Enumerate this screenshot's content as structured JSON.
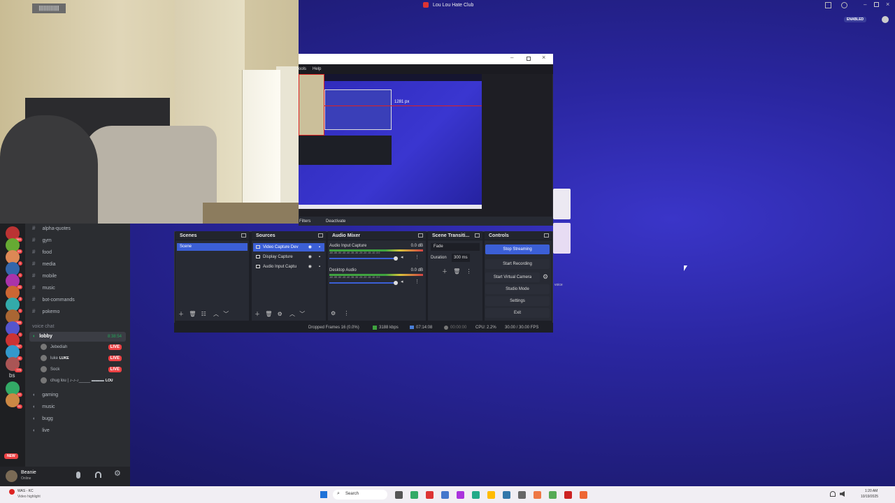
{
  "topbar": {
    "title": "Lou Lou Hate Club",
    "enabled_badge": "ENABLED"
  },
  "webcam": {
    "label": "||||||||||||||"
  },
  "discord": {
    "servers": [
      {
        "badge": "864"
      },
      {
        "badge": "63"
      },
      {
        "badge": "1"
      },
      {
        "badge": "1"
      },
      {
        "badge": "34"
      },
      {
        "badge": "3"
      },
      {
        "badge": "1"
      },
      {
        "badge": "366"
      },
      {
        "badge": "1"
      },
      {
        "badge": "267"
      },
      {
        "badge": "11"
      },
      {
        "badge": "779"
      },
      {
        "badge": "92"
      },
      {
        "badge": "61"
      }
    ],
    "server_initials": "bs",
    "new_badge": "NEW",
    "channels": [
      {
        "name": "alpha-quotes"
      },
      {
        "name": "gym"
      },
      {
        "name": "food"
      },
      {
        "name": "media"
      },
      {
        "name": "mobile"
      },
      {
        "name": "music"
      },
      {
        "name": "bot-commands"
      },
      {
        "name": "pokemo"
      }
    ],
    "voice_category": "voice chat",
    "lobby": {
      "name": "lobby",
      "time": "8:38:54"
    },
    "voice_users": [
      {
        "name": "Jebediah",
        "live": "LIVE"
      },
      {
        "name": "luke",
        "tag": "LUKE",
        "live": "LIVE"
      },
      {
        "name": "Sock",
        "live": "LIVE"
      },
      {
        "name": "chug lou | ♪-♪-♪_____ ▬▬▬",
        "tag": "LOU"
      }
    ],
    "voice_channels": [
      {
        "name": "gaming"
      },
      {
        "name": "music"
      },
      {
        "name": "bugg"
      },
      {
        "name": "live"
      }
    ],
    "user": {
      "name": "Beanie",
      "status": "Online"
    }
  },
  "obs": {
    "menu": {
      "tools": "ools",
      "help": "Help"
    },
    "preview_label": "1281 px",
    "filters": "Filters",
    "deactivate": "Deactivate",
    "scenes": {
      "title": "Scenes",
      "items": [
        "Scene"
      ]
    },
    "sources": {
      "title": "Sources",
      "items": [
        "Video Capture Dev",
        "Display Capture",
        "Audio Input Captu"
      ]
    },
    "mixer": {
      "title": "Audio Mixer",
      "channels": [
        {
          "name": "Audio Input Capture",
          "db": "0.0 dB"
        },
        {
          "name": "Desktop Audio",
          "db": "0.0 dB"
        }
      ],
      "scale": "-60 -55 -50 -45 -40 -35 -30 -25 -20 -15 -10 -5 0"
    },
    "transitions": {
      "title": "Scene Transiti...",
      "type": "Fade",
      "duration_label": "Duration",
      "duration": "300 ms"
    },
    "controls": {
      "title": "Controls",
      "stop_streaming": "Stop Streaming",
      "start_recording": "Start Recording",
      "start_virtual": "Start Virtual Camera",
      "studio": "Studio Mode",
      "settings": "Settings",
      "exit": "Exit"
    },
    "status": {
      "dropped": "Dropped Frames 16 (0.0%)",
      "kbps": "3188 kbps",
      "stream_time": "07:14:08",
      "rec_time": "00:00:00",
      "cpu": "CPU: 2.2%",
      "fps": "30.00 / 30.00 FPS"
    },
    "voice_label": "voice"
  },
  "taskbar": {
    "notification_title": "WAS - KC",
    "notification_sub": "Video highlight",
    "search": "Search",
    "time": "1:20 AM",
    "date": "10/19/2025"
  }
}
